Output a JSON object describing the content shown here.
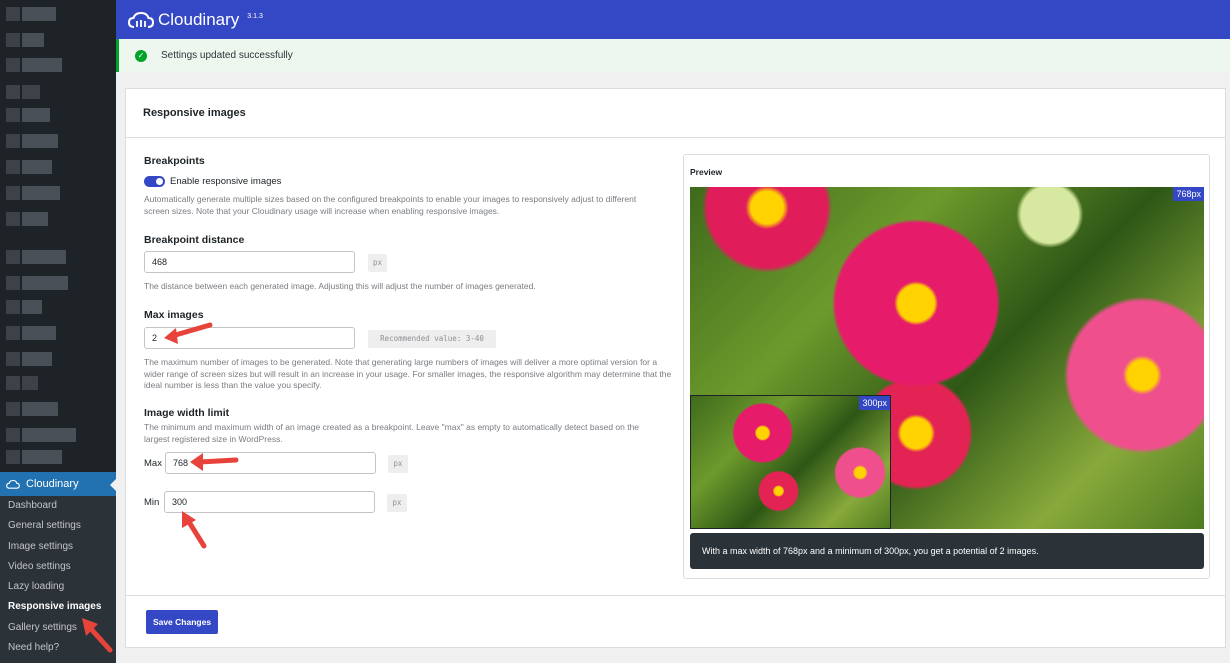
{
  "brand": {
    "name": "Cloudinary",
    "version": "3.1.3"
  },
  "notice": {
    "text": "Settings updated successfully"
  },
  "sidebar": {
    "plugin_label": "Cloudinary",
    "items": [
      {
        "label": "Dashboard"
      },
      {
        "label": "General settings"
      },
      {
        "label": "Image settings"
      },
      {
        "label": "Video settings"
      },
      {
        "label": "Lazy loading"
      },
      {
        "label": "Responsive images"
      },
      {
        "label": "Gallery settings"
      },
      {
        "label": "Need help?"
      }
    ]
  },
  "panel": {
    "title": "Responsive images",
    "breakpoints": {
      "title": "Breakpoints",
      "toggle_label": "Enable responsive images",
      "toggle_on": true,
      "help": "Automatically generate multiple sizes based on the configured breakpoints to enable your images to responsively adjust to different screen sizes. Note that your Cloudinary usage will increase when enabling responsive images."
    },
    "distance": {
      "title": "Breakpoint distance",
      "value": "468",
      "unit": "px",
      "help": "The distance between each generated image. Adjusting this will adjust the number of images generated."
    },
    "max_images": {
      "title": "Max images",
      "value": "2",
      "hint": "Recommended value: 3-40",
      "help": "The maximum number of images to be generated. Note that generating large numbers of images will deliver a more optimal version for a wider range of screen sizes but will result in an increase in your usage. For smaller images, the responsive algorithm may determine that the ideal number is less than the value you specify."
    },
    "width_limit": {
      "title": "Image width limit",
      "help": "The minimum and maximum width of an image created as a breakpoint. Leave \"max\" as empty to automatically detect based on the largest registered size in WordPress.",
      "max_label": "Max",
      "max_value": "768",
      "min_label": "Min",
      "min_value": "300",
      "unit": "px"
    },
    "preview": {
      "title": "Preview",
      "big_tag": "768px",
      "small_tag": "300px",
      "caption": "With a max width of 768px and a minimum of 300px, you get a potential of 2 images."
    },
    "save_label": "Save Changes"
  },
  "colors": {
    "accent": "#3448c5",
    "sidebar": "#1d2327",
    "success": "#00a32a",
    "annotation": "#e8433b"
  }
}
